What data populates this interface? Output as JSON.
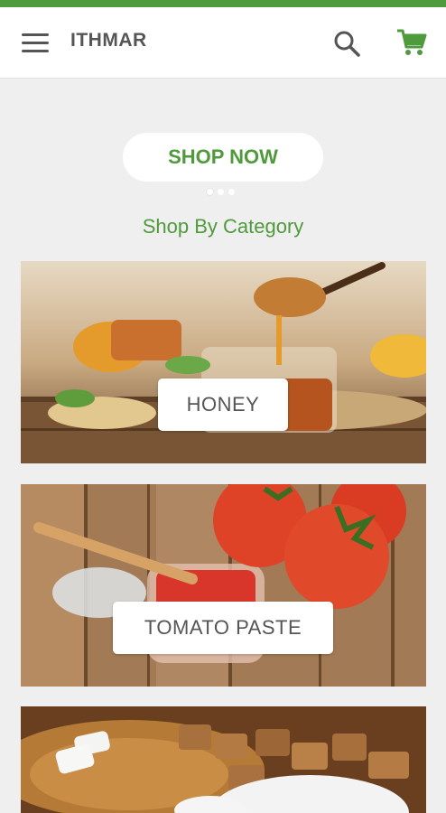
{
  "header": {
    "title": "ITHMAR",
    "accent_color": "#4f9a3c",
    "menu_icon": "hamburger-menu-icon",
    "search_icon": "search-icon",
    "cart_icon": "shopping-cart-icon"
  },
  "hero": {
    "shop_now_label": "SHOP NOW",
    "carousel_pages": 3,
    "active_page": 1
  },
  "categories": {
    "title": "Shop By Category",
    "items": [
      {
        "label": "HONEY"
      },
      {
        "label": "TOMATO PASTE"
      },
      {
        "label": ""
      }
    ]
  }
}
